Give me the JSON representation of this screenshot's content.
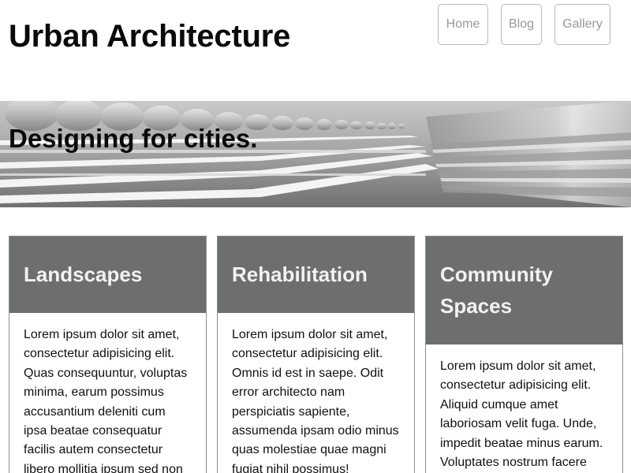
{
  "site": {
    "title": "Urban Architecture"
  },
  "nav": {
    "items": [
      {
        "label": "Home"
      },
      {
        "label": "Blog"
      },
      {
        "label": "Gallery"
      }
    ]
  },
  "hero": {
    "tagline": "Designing for cities."
  },
  "cards": [
    {
      "title": "Landscapes",
      "body": "Lorem ipsum dolor sit amet, consectetur adipisicing elit. Quas consequuntur, voluptas minima, earum possimus accusantium deleniti cum ipsa beatae consequatur facilis autem consectetur libero mollitia ipsum sed non"
    },
    {
      "title": "Rehabilitation",
      "body": "Lorem ipsum dolor sit amet, consectetur adipisicing elit. Omnis id est in saepe. Odit error architecto nam perspiciatis sapiente, assumenda ipsam odio minus quas molestiae quae magni fugiat nihil possimus!"
    },
    {
      "title": "Community Spaces",
      "body": "Lorem ipsum dolor sit amet, consectetur adipisicing elit. Aliquid cumque amet laboriosam velit fuga. Unde, impedit beatae minus earum. Voluptates nostrum facere"
    }
  ],
  "colors": {
    "card_header_bg": "#6d6e6e",
    "card_header_text": "#f2f2f2",
    "nav_text": "#999999",
    "nav_border": "#b8b8b8"
  }
}
